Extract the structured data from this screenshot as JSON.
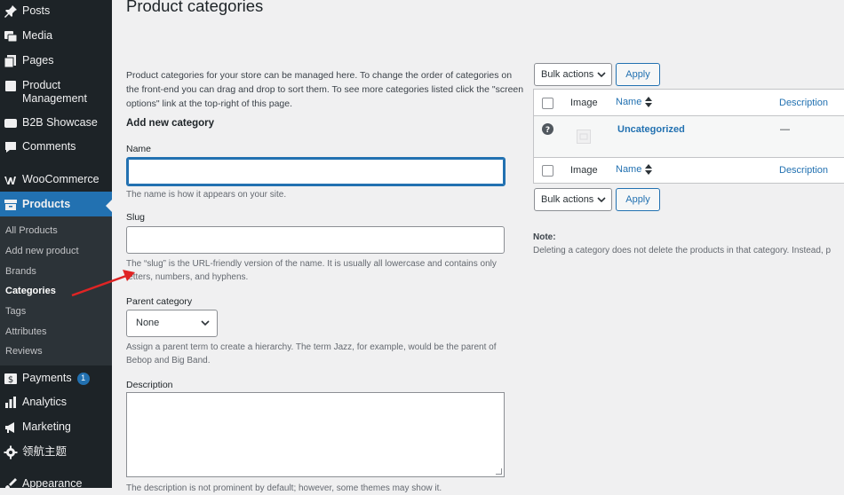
{
  "sidebar": {
    "items": [
      {
        "label": "Posts",
        "icon": "pin-icon"
      },
      {
        "label": "Media",
        "icon": "media-icon"
      },
      {
        "label": "Pages",
        "icon": "pages-icon"
      },
      {
        "label": "Product",
        "label2": "Management",
        "icon": "product-icon"
      },
      {
        "label": "B2B Showcase",
        "icon": "showcase-icon"
      },
      {
        "label": "Comments",
        "icon": "comment-icon"
      },
      {
        "label": "WooCommerce",
        "icon": "woo-icon"
      },
      {
        "label": "Products",
        "icon": "archive-icon"
      },
      {
        "label": "Payments",
        "badge": "1",
        "icon": "payments-icon"
      },
      {
        "label": "Analytics",
        "icon": "analytics-icon"
      },
      {
        "label": "Marketing",
        "icon": "megaphone-icon"
      },
      {
        "label": "领航主题",
        "icon": "gear-icon"
      },
      {
        "label": "Appearance",
        "icon": "brush-icon"
      }
    ],
    "submenu": [
      "All Products",
      "Add new product",
      "Brands",
      "Categories",
      "Tags",
      "Attributes",
      "Reviews"
    ]
  },
  "page": {
    "title": "Product categories",
    "intro": "Product categories for your store can be managed here. To change the order of categories on the front-end you can drag and drop to sort them. To see more categories listed click the \"screen options\" link at the top-right of this page."
  },
  "form": {
    "heading": "Add new category",
    "name_label": "Name",
    "name_value": "",
    "name_help": "The name is how it appears on your site.",
    "slug_label": "Slug",
    "slug_value": "",
    "slug_help": "The “slug” is the URL-friendly version of the name. It is usually all lowercase and contains only letters, numbers, and hyphens.",
    "parent_label": "Parent category",
    "parent_value": "None",
    "parent_help": "Assign a parent term to create a hierarchy. The term Jazz, for example, would be the parent of Bebop and Big Band.",
    "desc_label": "Description",
    "desc_help": "The description is not prominent by default; however, some themes may show it."
  },
  "table": {
    "bulk_label": "Bulk actions",
    "apply_label": "Apply",
    "columns": {
      "image": "Image",
      "name": "Name",
      "description": "Description"
    },
    "rows": [
      {
        "name": "Uncategorized",
        "description": "—"
      }
    ]
  },
  "note": {
    "label": "Note:",
    "text": "Deleting a category does not delete the products in that category. Instead, p"
  },
  "colors": {
    "accent": "#2271b1",
    "sidebar": "#1d2327",
    "annotation": "#e02424"
  }
}
